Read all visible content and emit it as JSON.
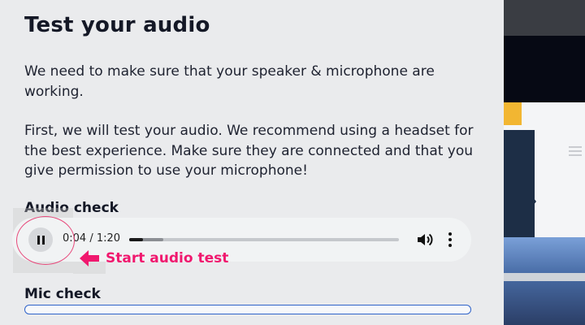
{
  "panel": {
    "title": "Test your audio",
    "intro": "We need to make sure that your speaker & microphone are working.",
    "instructions": "First, we will test your audio. We recommend using a headset for the best experience. Make sure they are connected and that you give permission to use your microphone!"
  },
  "audio_check": {
    "label": "Audio check",
    "player": {
      "current_time": "0:04",
      "separator": " / ",
      "duration": "1:20",
      "progress_fraction": 0.05,
      "buffered_fraction": 0.125,
      "state": "playing"
    },
    "annotation": {
      "text": "Start audio test",
      "color": "#f0186e"
    }
  },
  "mic_check": {
    "label": "Mic check",
    "level_fraction": 0.0,
    "meter_color": "#2f63c9"
  },
  "icons": {
    "pause": "pause-icon",
    "volume": "volume-icon",
    "more": "more-vertical-icon",
    "arrow": "arrow-left-icon"
  },
  "colors": {
    "panel_bg": "#eaebed",
    "accent": "#f0186e",
    "player_bg": "#f1f3f4"
  }
}
